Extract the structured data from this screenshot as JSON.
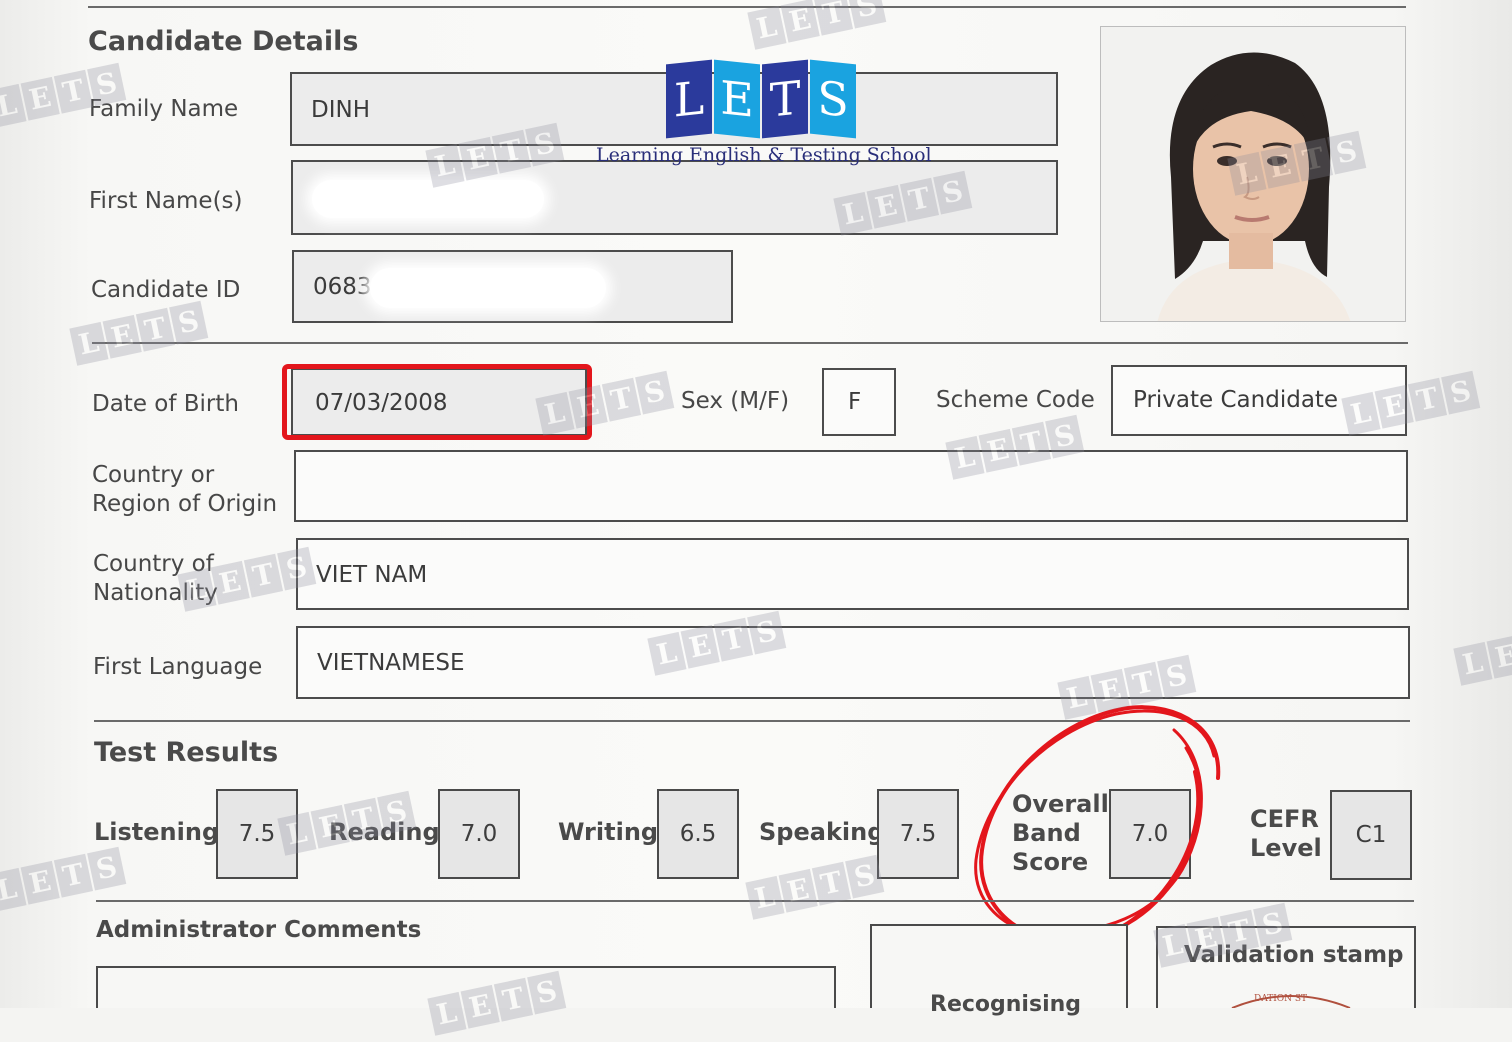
{
  "logo": {
    "letters": [
      "L",
      "E",
      "T",
      "S"
    ],
    "tagline": "Learning English & Testing School",
    "colors": [
      "#2b3a9c",
      "#1aa3e0",
      "#2b3a9c",
      "#1aa3e0"
    ]
  },
  "candidate": {
    "section_title": "Candidate Details",
    "family_name_label": "Family Name",
    "family_name": "DINH",
    "first_names_label": "First Name(s)",
    "first_names": "",
    "candidate_id_label": "Candidate ID",
    "candidate_id": "0683",
    "dob_label": "Date of Birth",
    "dob": "07/03/2008",
    "sex_label": "Sex (M/F)",
    "sex": "F",
    "scheme_code_label": "Scheme Code",
    "scheme_code": "Private Candidate",
    "country_origin_label_1": "Country or",
    "country_origin_label_2": "Region of Origin",
    "country_origin": "",
    "nationality_label_1": "Country of",
    "nationality_label_2": "Nationality",
    "nationality": "VIET NAM",
    "first_language_label": "First Language",
    "first_language": "VIETNAMESE"
  },
  "results": {
    "section_title": "Test Results",
    "listening_label": "Listening",
    "listening": "7.5",
    "reading_label": "Reading",
    "reading": "7.0",
    "writing_label": "Writing",
    "writing": "6.5",
    "speaking_label": "Speaking",
    "speaking": "7.5",
    "overall_label_1": "Overall",
    "overall_label_2": "Band",
    "overall_label_3": "Score",
    "overall": "7.0",
    "cefr_label_1": "CEFR",
    "cefr_label_2": "Level",
    "cefr": "C1"
  },
  "footer": {
    "admin_comments_title": "Administrator Comments",
    "recognising_label": "Recognising",
    "validation_stamp_label": "Validation stamp",
    "stamp_text": "DATION ST"
  },
  "watermark": {
    "letters": [
      "L",
      "E",
      "T",
      "S"
    ]
  },
  "highlight_color": "#e3161c"
}
